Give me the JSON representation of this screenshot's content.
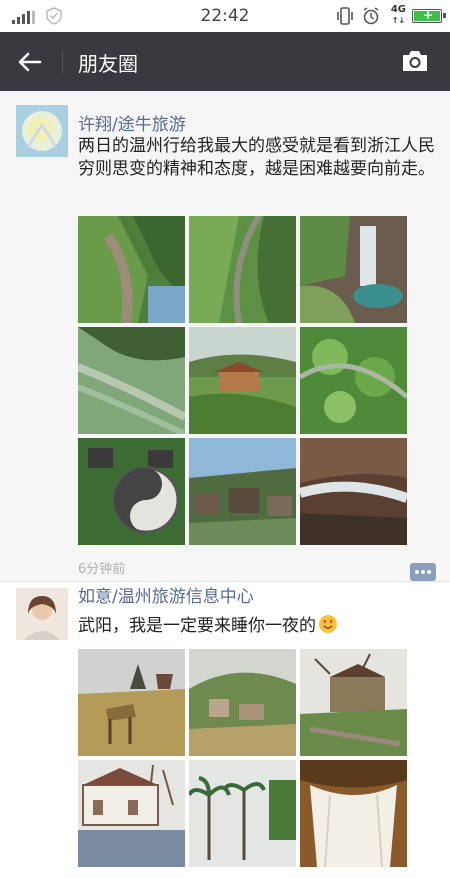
{
  "status_bar": {
    "time": "22:42",
    "network": "4G"
  },
  "navbar": {
    "title": "朋友圈"
  },
  "posts": [
    {
      "username": "许翔/途牛旅游",
      "text": "两日的温州行给我最大的感受就是看到浙江人民穷则思变的精神和态度，越是困难越要向前走。",
      "time": "6分钟前",
      "images": [
        "canyon-aerial",
        "mountain-valley",
        "waterfall-pool",
        "terraced-fields",
        "wooden-pavilion",
        "green-slope",
        "taiji-courtyard",
        "village-rooftops",
        "rocky-stream"
      ]
    },
    {
      "username": "如意/温州旅游信息中心",
      "text": "武阳，我是一定要来睡你一夜的",
      "emoji": "heart-eyes-emoji",
      "images": [
        "wooden-deer-field",
        "mountain-village",
        "stone-buildings",
        "building-bare-trees",
        "palm-trees-street",
        "canopy-bed"
      ]
    }
  ]
}
